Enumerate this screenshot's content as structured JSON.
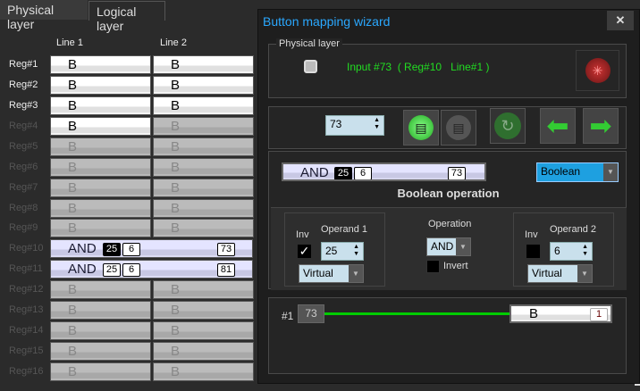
{
  "tabs": [
    {
      "label": "Physical layer",
      "active": true
    },
    {
      "label": "Logical layer",
      "active": false
    }
  ],
  "grid": {
    "columns": [
      "Line 1",
      "Line 2"
    ],
    "rows": [
      {
        "label": "Reg#1",
        "enabled": true,
        "cells": [
          {
            "text": "B",
            "on": true
          },
          {
            "text": "B",
            "on": true
          }
        ]
      },
      {
        "label": "Reg#2",
        "enabled": true,
        "cells": [
          {
            "text": "B",
            "on": true
          },
          {
            "text": "B",
            "on": true
          }
        ]
      },
      {
        "label": "Reg#3",
        "enabled": true,
        "cells": [
          {
            "text": "B",
            "on": true
          },
          {
            "text": "B",
            "on": true
          }
        ]
      },
      {
        "label": "Reg#4",
        "enabled": false,
        "cells": [
          {
            "text": "B",
            "on": true
          },
          {
            "text": "B",
            "on": false
          }
        ]
      },
      {
        "label": "Reg#5",
        "enabled": false,
        "cells": [
          {
            "text": "B",
            "on": false
          },
          {
            "text": "B",
            "on": false
          }
        ]
      },
      {
        "label": "Reg#6",
        "enabled": false,
        "cells": [
          {
            "text": "B",
            "on": false
          },
          {
            "text": "B",
            "on": false
          }
        ]
      },
      {
        "label": "Reg#7",
        "enabled": false,
        "cells": [
          {
            "text": "B",
            "on": false
          },
          {
            "text": "B",
            "on": false
          }
        ]
      },
      {
        "label": "Reg#8",
        "enabled": false,
        "cells": [
          {
            "text": "B",
            "on": false
          },
          {
            "text": "B",
            "on": false
          }
        ]
      },
      {
        "label": "Reg#9",
        "enabled": false,
        "cells": [
          {
            "text": "B",
            "on": false
          },
          {
            "text": "B",
            "on": false
          }
        ]
      },
      {
        "label": "Reg#10",
        "enabled": false,
        "logic": {
          "op": "AND",
          "a": "25",
          "b": "6",
          "out": "73",
          "a_selected": true
        }
      },
      {
        "label": "Reg#11",
        "enabled": false,
        "logic": {
          "op": "AND",
          "a": "25",
          "b": "6",
          "out": "81",
          "a_selected": false
        }
      },
      {
        "label": "Reg#12",
        "enabled": false,
        "cells": [
          {
            "text": "B",
            "on": false
          },
          {
            "text": "B",
            "on": false
          }
        ]
      },
      {
        "label": "Reg#13",
        "enabled": false,
        "cells": [
          {
            "text": "B",
            "on": false
          },
          {
            "text": "B",
            "on": false
          }
        ]
      },
      {
        "label": "Reg#14",
        "enabled": false,
        "cells": [
          {
            "text": "B",
            "on": false
          },
          {
            "text": "B",
            "on": false
          }
        ]
      },
      {
        "label": "Reg#15",
        "enabled": false,
        "cells": [
          {
            "text": "B",
            "on": false
          },
          {
            "text": "B",
            "on": false
          }
        ]
      },
      {
        "label": "Reg#16",
        "enabled": false,
        "cells": [
          {
            "text": "B",
            "on": false
          },
          {
            "text": "B",
            "on": false
          }
        ]
      }
    ]
  },
  "dialog": {
    "title": "Button mapping wizard",
    "close": "✕",
    "physical": {
      "legend": "Physical layer",
      "input_text": "Input #73  ( Reg#10   Line#1 )"
    },
    "toolbar": {
      "input_number": "73"
    },
    "boolean": {
      "preview": {
        "op": "AND",
        "a": "25",
        "b": "6",
        "out": "73"
      },
      "type": "Boolean",
      "heading": "Boolean operation",
      "operand1": {
        "label": "Operand 1",
        "inv_label": "Inv",
        "inv_checked": true,
        "value": "25",
        "source": "Virtual"
      },
      "operation": {
        "label": "Operation",
        "value": "AND",
        "invert_label": "Invert",
        "invert_checked": false
      },
      "operand2": {
        "label": "Operand 2",
        "inv_label": "Inv",
        "inv_checked": false,
        "value": "6",
        "source": "Virtual"
      }
    },
    "output": {
      "index": "#1",
      "input": "73",
      "cell_text": "B",
      "cell_badge": "1"
    }
  },
  "colors": {
    "title": "#2aa8ff",
    "green_text": "#22dd22",
    "link_line": "#00cc00",
    "combo_bg": "#1ea0e0"
  }
}
